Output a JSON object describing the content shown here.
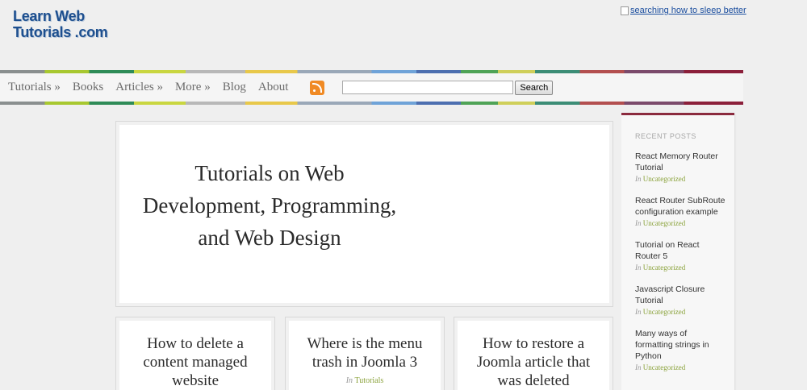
{
  "site": {
    "logo_line1": "Learn Web",
    "logo_line2": "Tutorials .com",
    "ad_link": "searching how to sleep better"
  },
  "nav": {
    "items": [
      "Tutorials »",
      "Books",
      "Articles »",
      "More »",
      "Blog",
      "About"
    ],
    "rss_icon": "rss-feed-icon",
    "search_placeholder": "",
    "search_button": "Search"
  },
  "hero": {
    "title": "Tutorials on Web Development, Programming, and Web Design"
  },
  "cards": [
    {
      "title": "How to delete a content managed website",
      "meta_prefix": "",
      "category": ""
    },
    {
      "title": "Where is the menu trash in Joomla 3",
      "meta_prefix": "In",
      "category": "Tutorials"
    },
    {
      "title": "How to restore a Joomla article that was deleted",
      "meta_prefix": "",
      "category": ""
    }
  ],
  "sidebar": {
    "heading": "RECENT POSTS",
    "posts": [
      {
        "title": "React Memory Router Tutorial",
        "meta_prefix": "In",
        "category": "Uncategorized"
      },
      {
        "title": "React Router SubRoute configuration example",
        "meta_prefix": "In",
        "category": "Uncategorized"
      },
      {
        "title": "Tutorial on React Router 5",
        "meta_prefix": "In",
        "category": "Uncategorized"
      },
      {
        "title": "Javascript Closure Tutorial",
        "meta_prefix": "In",
        "category": "Uncategorized"
      },
      {
        "title": "Many ways of formatting strings in Python",
        "meta_prefix": "In",
        "category": "Uncategorized"
      }
    ]
  },
  "colors": {
    "logo": "#1d4f8f",
    "nav_text": "#6c6c6c",
    "category": "#8aa23a",
    "sidebar_accent": "#8b2a3e",
    "rss": "#f08a24"
  }
}
